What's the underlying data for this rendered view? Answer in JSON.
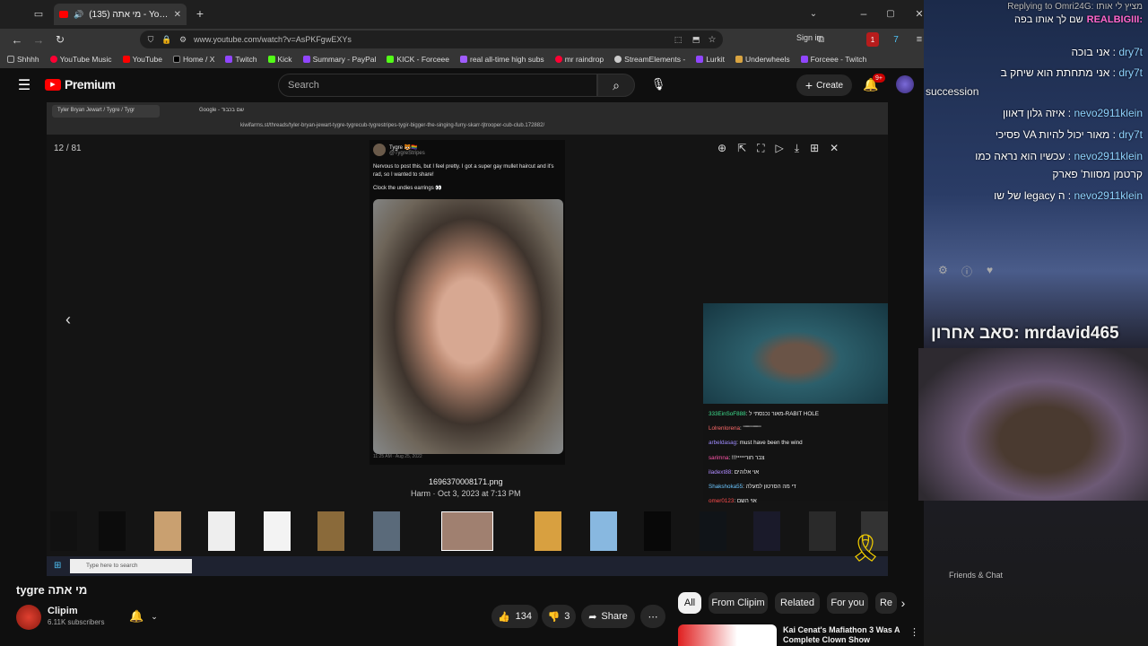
{
  "browser": {
    "tab_title": "(135) מי אתה - YouTube",
    "url": "www.youtube.com/watch?v=AsPKFgwEXYs",
    "sign_in": "Sign in",
    "bookmarks": [
      "Shhhh",
      "YouTube Music",
      "YouTube",
      "Home / X",
      "Twitch",
      "Kick",
      "Summary - PayPal",
      "KICK - Forceee",
      "real all-time high subs",
      "mr raindrop",
      "StreamElements -",
      "Lurkit",
      "Underwheels",
      "Forceee - Twitch"
    ]
  },
  "youtube": {
    "logo": "Premium",
    "search_placeholder": "Search",
    "create": "Create",
    "notif_badge": "9+",
    "video_title": "tygre מי אתה",
    "channel": "Clipim",
    "subscribers": "6.11K subscribers",
    "likes": "134",
    "dislikes": "3",
    "share": "Share",
    "chips": [
      "All",
      "From Clipim",
      "Related",
      "For you",
      "Re"
    ],
    "rec_title": "Kai Cenat's Mafiathon 3 Was A Complete Clown Show"
  },
  "video": {
    "inner_tab": "Tyler Bryan Jewart / Tygre / Tygr",
    "inner_tab2": "Google - שם בכבוד",
    "inner_url": "kiwifarms.st/threads/tyler-bryan-jewart-tygre-tygrecub-tygrestripes-tygir-bigger-the-singing-furry-skarr-tjtrooper-cub-club.172882/",
    "counter": "12 / 81",
    "tweet_name": "Tygre 🐯🏳️‍🌈",
    "tweet_handle": "@TygreStripes",
    "tweet_text": "Nervous to post this, but I feel pretty. I got a super gay mullet haircut and it's rad, so I wanted to share!",
    "tweet_text2": "Clock the undies earrings 👀",
    "tweet_date": "11:25 AM · Aug 25, 2022",
    "filename": "1696370008171.png",
    "file_meta": "Harm · Oct 3, 2023 at 7:13 PM",
    "taskbar_search": "Type here to search",
    "stream_chat": [
      {
        "user": "333EinSoF888",
        "msg": ": מאור נכנסתי ל-RABIT HOLE",
        "color": "#3ee08f"
      },
      {
        "user": "Lolrenlorena",
        "msg": ": \"\"\"\"\"\"\"\"\"",
        "color": "#ff6b6b"
      },
      {
        "user": "arbeldasag",
        "msg": ": must have been the wind",
        "color": "#9f8cff"
      },
      {
        "user": "sarimna",
        "msg": ": !!!צבר חוריייייי",
        "color": "#ff55aa"
      },
      {
        "user": "iladext88",
        "msg": ": אוי אלוהים",
        "color": "#b08cff"
      },
      {
        "user": "Shakshoka55",
        "msg": ": די מה הסרטון למעלה",
        "color": "#6cc6ff"
      },
      {
        "user": "omer0123",
        "msg": ": אוי השם",
        "color": "#ff4d4d"
      }
    ]
  },
  "twitch": {
    "reply_header": "Replying to Omri24G: מציץ לי אותו",
    "pinned_user": "REALBIGIII:",
    "pinned_msg": "שם לך אותו בפה",
    "messages": [
      {
        "user": "dry7t",
        "msg": "אני בוכה :"
      },
      {
        "user": "dry7t",
        "msg": "אני מתחתת הוא שיחק ב :",
        "extra": "succession"
      },
      {
        "user": "nevo2911klein",
        "msg": "איזה גלון דאוון :"
      },
      {
        "user": "dry7t",
        "msg": "פסיכי VA מאור יכול להיות :"
      },
      {
        "user": "nevo2911klein",
        "msg": "עכשיו הוא נראה כמו :",
        "extra": "קרטמן מסוות' פארק"
      },
      {
        "user": "nevo2911klein",
        "msg": "של שו legacy ה :"
      }
    ],
    "last_sub": "סאב אחרון: mrdavid465",
    "friends": "Friends & Chat"
  }
}
